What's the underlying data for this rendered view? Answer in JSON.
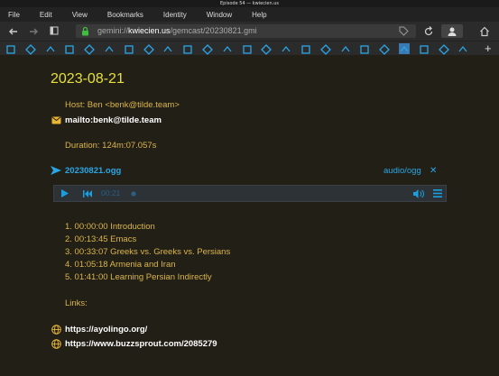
{
  "window": {
    "title": "Episode 54 — kwiecien.us"
  },
  "menu": [
    "File",
    "Edit",
    "View",
    "Bookmarks",
    "Identity",
    "Window",
    "Help"
  ],
  "toolbar": {
    "back_icon": "back-arrow-icon",
    "forward_icon": "forward-arrow-icon",
    "sidebar_icon": "sidebar-toggle-icon",
    "url_scheme": "gemini://",
    "url_host": "kwiecien.us",
    "url_path": "/gemcast/20230821.gmi",
    "actions": [
      "bookmark-tag-icon",
      "reload-icon",
      "identity-icon",
      "home-icon"
    ]
  },
  "bookmarks": {
    "count": 24,
    "active_index": 20,
    "accent": "#2aa6e6"
  },
  "page": {
    "heading": "2023-08-21",
    "host_line": "Host: Ben <benk@tilde.team>",
    "mail_link": "mailto:benk@tilde.team",
    "duration": "Duration: 124m:07.057s",
    "audio_link": "20230821.ogg",
    "audio_type": "audio/ogg",
    "audio_close": "✕",
    "player": {
      "time": "00:21",
      "progress": 0.0
    },
    "chapters": [
      "1. 00:00:00 Introduction",
      "2. 00:13:45 Emacs",
      "3. 00:33:07 Greeks vs. Greeks vs. Persians",
      "4. 01:05:18 Armenia and Iran",
      "5. 01:41:00 Learning Persian Indirectly"
    ],
    "links_label": "Links:",
    "links": [
      "https://ayolingo.org/",
      "https://www.buzzsprout.com/2085279"
    ]
  },
  "colors": {
    "heading": "#e7e03b",
    "text": "#dcb54a",
    "link": "#2aa6e6",
    "background": "#211f16"
  }
}
